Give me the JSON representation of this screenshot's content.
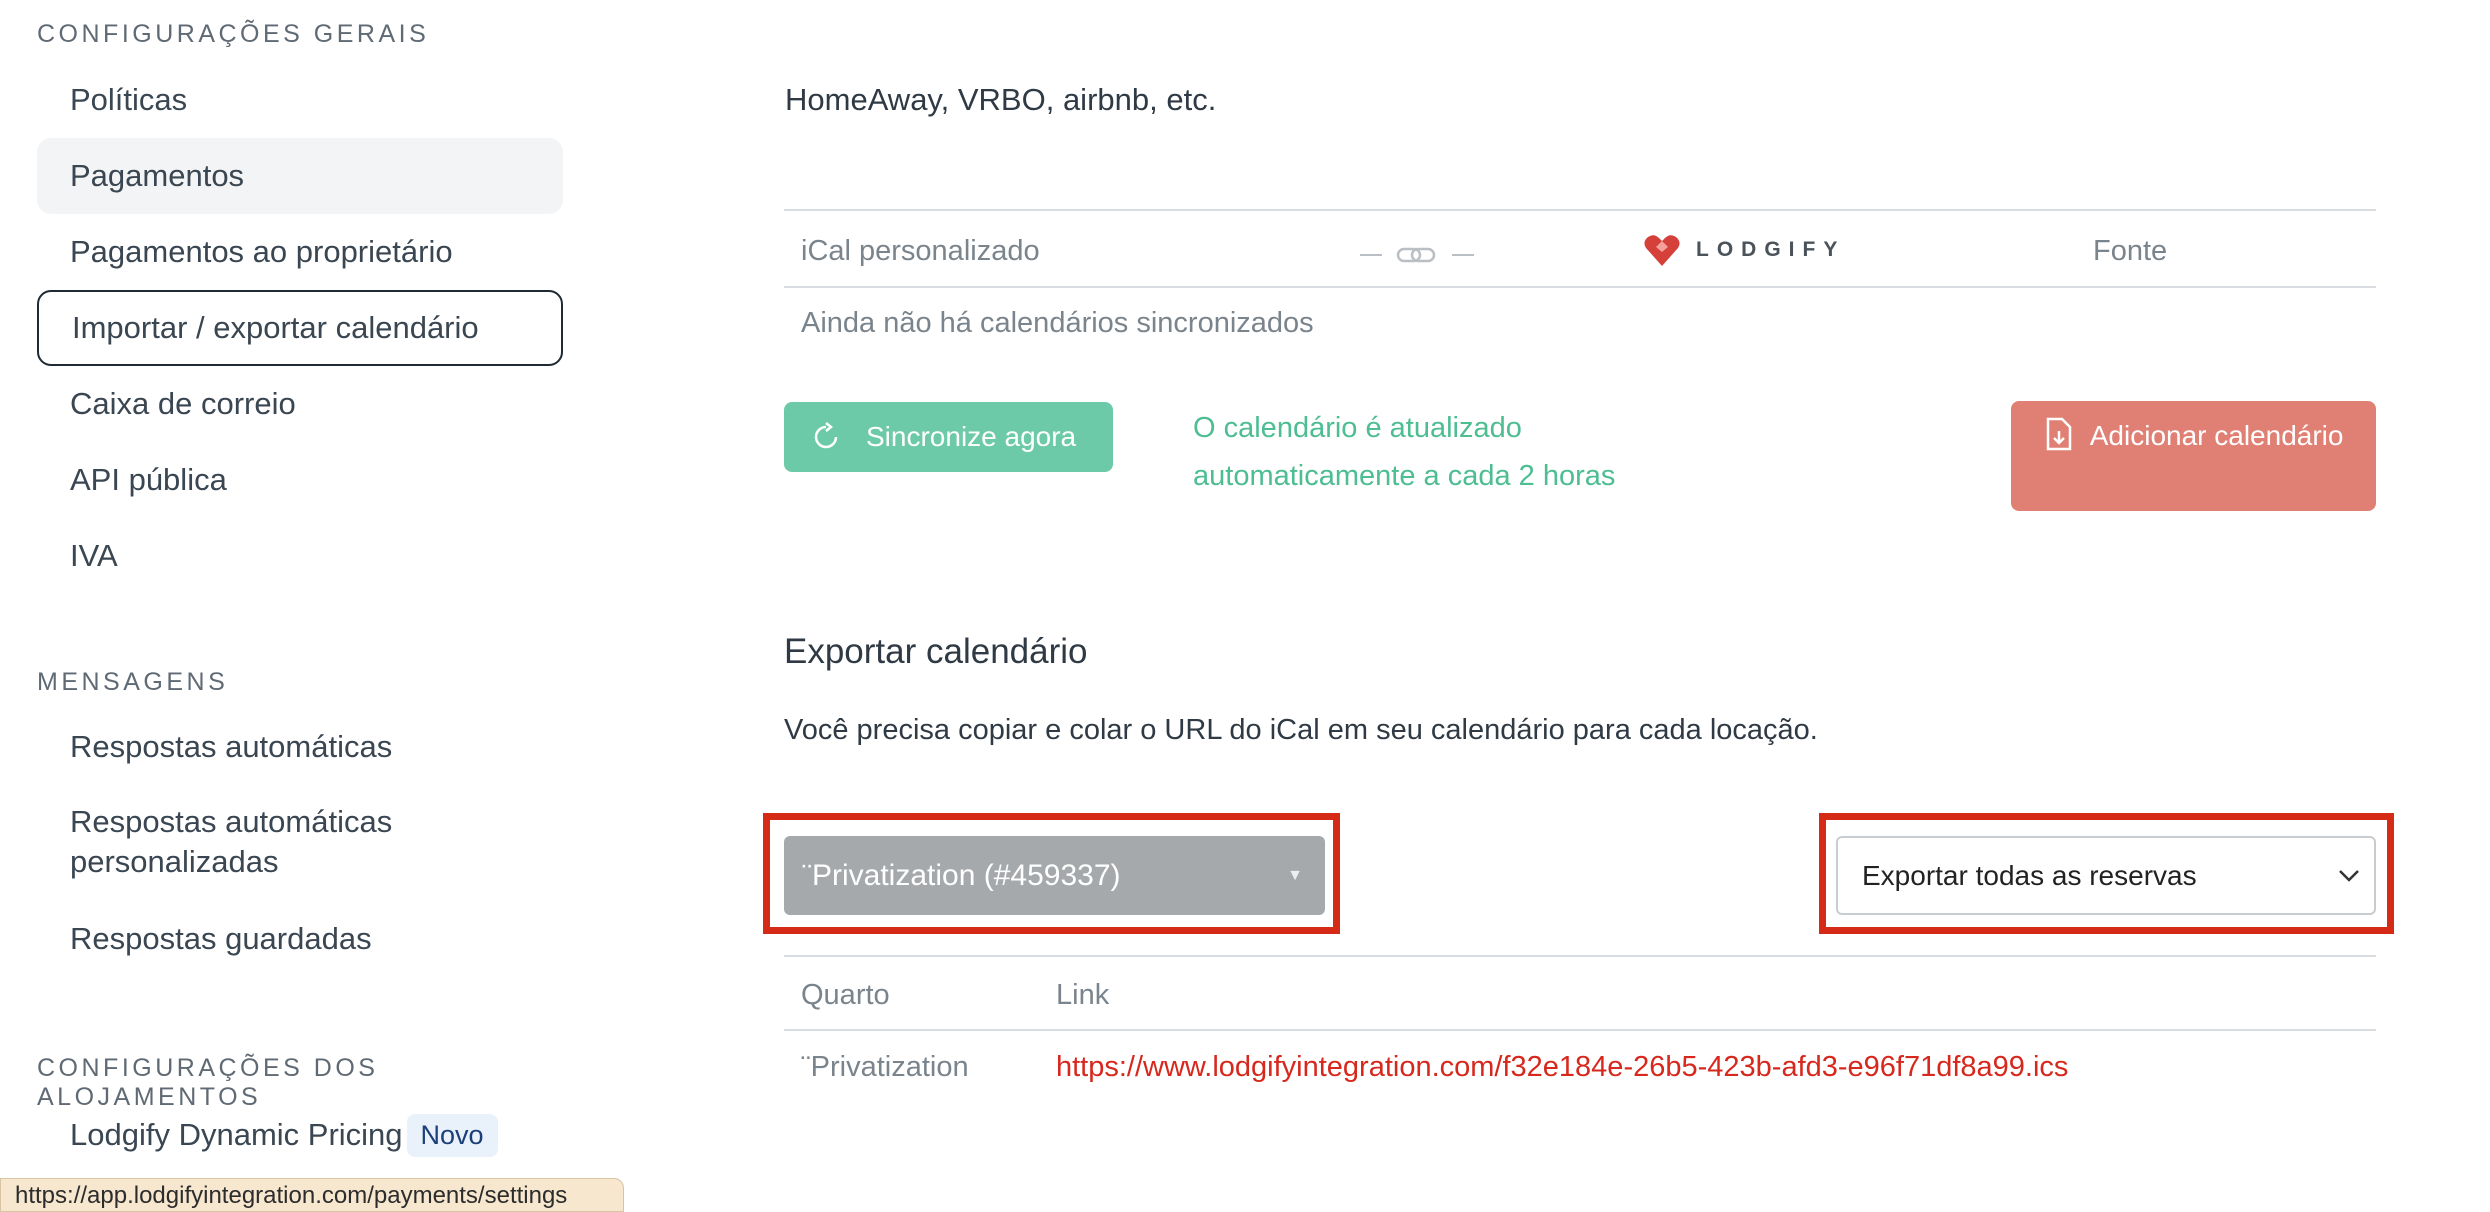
{
  "sidebar": {
    "general_title": "CONFIGURAÇÕES GERAIS",
    "general_items": [
      "Políticas",
      "Pagamentos",
      "Pagamentos ao proprietário",
      "Importar / exportar calendário",
      "Caixa de correio",
      "API pública",
      "IVA"
    ],
    "messages_title": "MENSAGENS",
    "messages_items": [
      "Respostas automáticas",
      "Respostas automáticas personalizadas",
      "Respostas guardadas"
    ],
    "accommodation_title": "CONFIGURAÇÕES DOS ALOJAMENTOS",
    "dynamic_pricing": "Lodgify Dynamic Pricing",
    "new_badge": "Novo"
  },
  "status_url": "https://app.lodgifyintegration.com/payments/settings",
  "import": {
    "cut_text": "HomeAway, VRBO, airbnb, etc.",
    "col_custom": "iCal personalizado",
    "col_brand": "LODGIFY",
    "col_source": "Fonte",
    "empty": "Ainda não há calendários sincronizados",
    "sync_button": "Sincronize agora",
    "auto_note": "O calendário é atualizado automaticamente a cada 2 horas",
    "add_button": "Adicionar calendário"
  },
  "export": {
    "title": "Exportar calendário",
    "description": "Você precisa copiar e colar o URL do iCal em seu calendário para cada locação.",
    "room_select": "¨Privatization (#459337)",
    "export_select": "Exportar todas as reservas",
    "col_room": "Quarto",
    "col_link": "Link",
    "rows": [
      {
        "room": "¨Privatization",
        "link": "https://www.lodgifyintegration.com/f32e184e-26b5-423b-afd3-e96f71df8a99.ics"
      }
    ]
  },
  "colors": {
    "sync_green": "#6ccaa8",
    "note_green": "#4dbd92",
    "add_red": "#e07f73",
    "highlight_red": "#d42a16",
    "link_red": "#d7281e"
  }
}
